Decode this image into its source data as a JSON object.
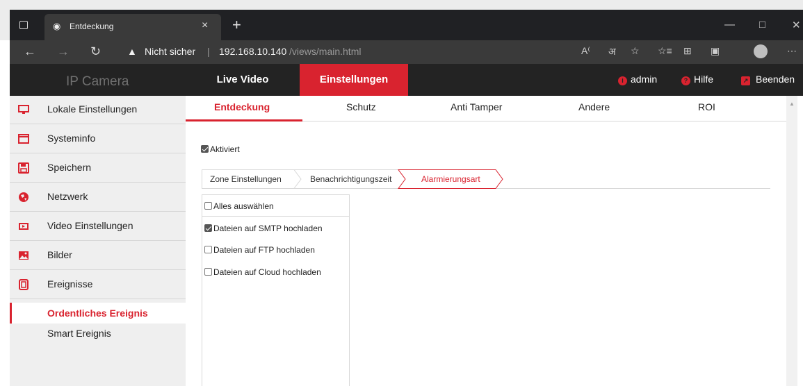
{
  "browser": {
    "tab_title": "Entdeckung",
    "security_label": "Nicht sicher",
    "url_host": "192.168.10.140",
    "url_path": "/views/main.html"
  },
  "app": {
    "brand": "IP Camera",
    "nav_tabs": [
      {
        "label": "Live Video",
        "active": false
      },
      {
        "label": "Einstellungen",
        "active": true
      }
    ],
    "header_right": {
      "user": "admin",
      "help": "Hilfe",
      "logout": "Beenden"
    },
    "accent_color": "#d9232f"
  },
  "sidebar": {
    "items": [
      {
        "label": "Lokale Einstellungen",
        "icon": "monitor-icon"
      },
      {
        "label": "Systeminfo",
        "icon": "window-icon"
      },
      {
        "label": "Speichern",
        "icon": "save-icon"
      },
      {
        "label": "Netzwerk",
        "icon": "globe-icon"
      },
      {
        "label": "Video Einstellungen",
        "icon": "video-icon"
      },
      {
        "label": "Bilder",
        "icon": "image-icon"
      },
      {
        "label": "Ereignisse",
        "icon": "events-icon"
      }
    ],
    "sub_items": [
      {
        "label": "Ordentliches Ereignis",
        "active": true
      },
      {
        "label": "Smart Ereignis",
        "active": false
      }
    ]
  },
  "content": {
    "tabs": [
      {
        "label": "Entdeckung",
        "active": true
      },
      {
        "label": "Schutz",
        "active": false
      },
      {
        "label": "Anti Tamper",
        "active": false
      },
      {
        "label": "Andere",
        "active": false
      },
      {
        "label": "ROI",
        "active": false
      }
    ],
    "enabled_label": "Aktiviert",
    "enabled_checked": true,
    "steps": [
      {
        "label": "Zone Einstellungen",
        "active": false
      },
      {
        "label": "Benachrichtigungszeit",
        "active": false
      },
      {
        "label": "Alarmierungsart",
        "active": true
      }
    ],
    "select_all_label": "Alles auswählen",
    "options": [
      {
        "label": "Dateien auf SMTP hochladen",
        "checked": true
      },
      {
        "label": "Dateien auf FTP hochladen",
        "checked": false
      },
      {
        "label": "Dateien auf Cloud hochladen",
        "checked": false
      }
    ]
  }
}
